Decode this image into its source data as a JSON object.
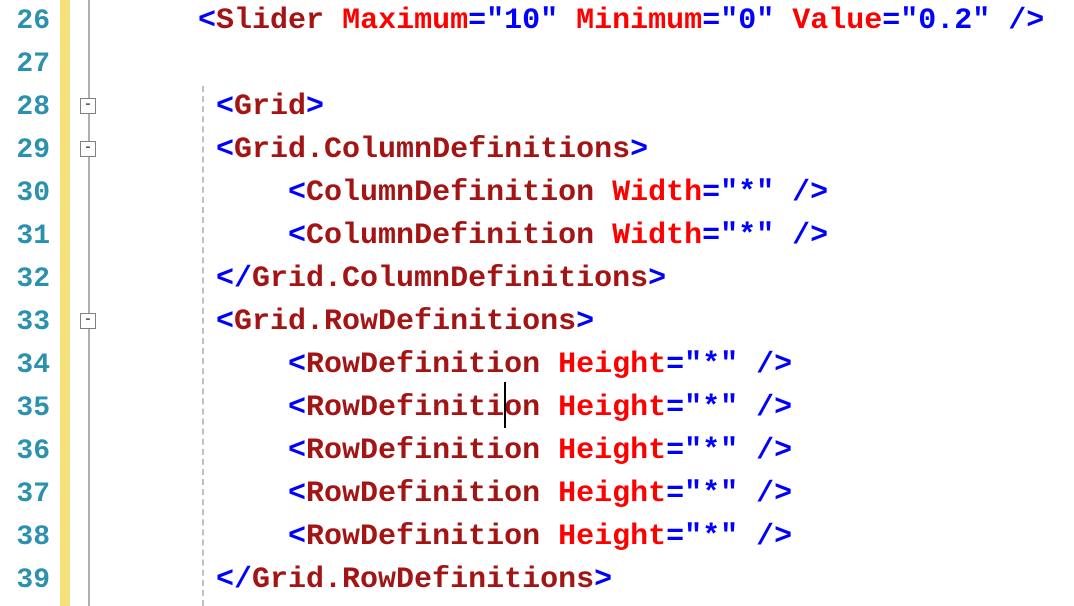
{
  "line_numbers": [
    "26",
    "27",
    "28",
    "29",
    "30",
    "31",
    "32",
    "33",
    "34",
    "35",
    "36",
    "37",
    "38",
    "39"
  ],
  "fold_boxes": [
    {
      "line_index": 2,
      "glyph": "-"
    },
    {
      "line_index": 3,
      "glyph": "-"
    },
    {
      "line_index": 7,
      "glyph": "-"
    }
  ],
  "code": {
    "l26": {
      "indent": "    ",
      "open": "<",
      "tag": "Slider",
      "sp": " ",
      "a1n": "Maximum",
      "eq1": "=",
      "a1v": "\"10\"",
      "sp2": " ",
      "a2n": "Minimum",
      "eq2": "=",
      "a2v": "\"0\"",
      "sp3": " ",
      "a3n": "Value",
      "eq3": "=",
      "a3v": "\"0.2\"",
      "close": " />"
    },
    "l27": {
      "text": ""
    },
    "l28": {
      "indent": "     ",
      "open": "<",
      "tag": "Grid",
      "close": ">"
    },
    "l29": {
      "indent": "     ",
      "open": "<",
      "tag": "Grid.ColumnDefinitions",
      "close": ">"
    },
    "l30": {
      "indent": "         ",
      "open": "<",
      "tag": "ColumnDefinition",
      "sp": " ",
      "an": "Width",
      "eq": "=",
      "av": "\"*\"",
      "close": " />"
    },
    "l31": {
      "indent": "         ",
      "open": "<",
      "tag": "ColumnDefinition",
      "sp": " ",
      "an": "Width",
      "eq": "=",
      "av": "\"*\"",
      "close": " />"
    },
    "l32": {
      "indent": "     ",
      "open": "</",
      "tag": "Grid.ColumnDefinitions",
      "close": ">"
    },
    "l33": {
      "indent": "     ",
      "open": "<",
      "tag": "Grid.RowDefinitions",
      "close": ">"
    },
    "l34": {
      "indent": "         ",
      "open": "<",
      "tag": "RowDefinition",
      "sp": " ",
      "an": "Height",
      "eq": "=",
      "av": "\"*\"",
      "close": " />"
    },
    "l35": {
      "indent": "         ",
      "open": "<",
      "tag": "RowDefinition",
      "sp": " ",
      "an": "Height",
      "eq": "=",
      "av": "\"*\"",
      "close": " />"
    },
    "l36": {
      "indent": "         ",
      "open": "<",
      "tag": "RowDefinition",
      "sp": " ",
      "an": "Height",
      "eq": "=",
      "av": "\"*\"",
      "close": " />"
    },
    "l37": {
      "indent": "         ",
      "open": "<",
      "tag": "RowDefinition",
      "sp": " ",
      "an": "Height",
      "eq": "=",
      "av": "\"*\"",
      "close": " />"
    },
    "l38": {
      "indent": "         ",
      "open": "<",
      "tag": "RowDefinition",
      "sp": " ",
      "an": "Height",
      "eq": "=",
      "av": "\"*\"",
      "close": " />"
    },
    "l39": {
      "indent": "     ",
      "open": "</",
      "tag": "Grid.RowDefinitions",
      "close": ">"
    }
  }
}
